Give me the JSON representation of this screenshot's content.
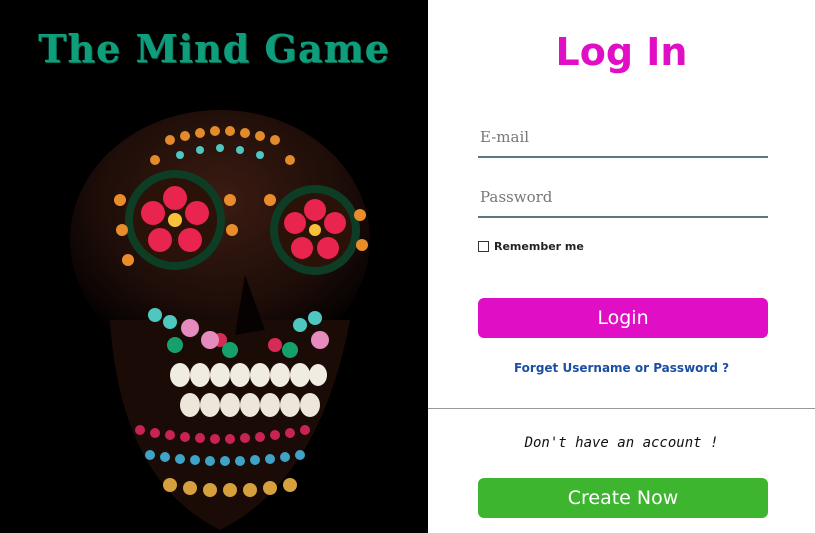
{
  "brand": {
    "title": "The Mind Game"
  },
  "login": {
    "title": "Log In",
    "email_placeholder": "E-mail",
    "password_placeholder": "Password",
    "remember_label": "Remember me",
    "login_button": "Login",
    "forgot_link": "Forget Username or Password ?"
  },
  "signup": {
    "prompt": "Don't have an account !",
    "create_button": "Create Now"
  },
  "colors": {
    "brand": "#0f9e7c",
    "accent_pink": "#e00fc5",
    "create_green": "#3db52e",
    "link_blue": "#1a4fa3"
  }
}
